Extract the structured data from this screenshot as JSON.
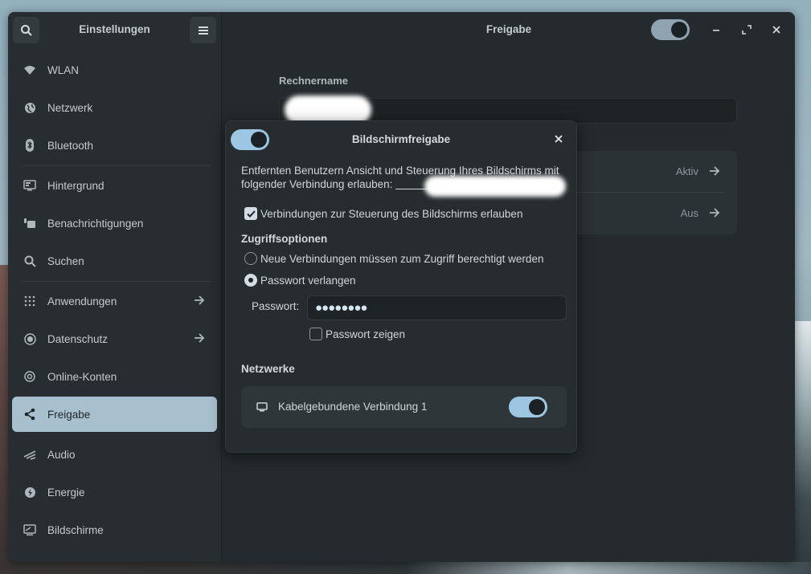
{
  "sidebar": {
    "title": "Einstellungen",
    "items": [
      {
        "label": "WLAN",
        "icon": "wifi-icon"
      },
      {
        "label": "Netzwerk",
        "icon": "network-globe-icon"
      },
      {
        "label": "Bluetooth",
        "icon": "bluetooth-icon"
      },
      {
        "label": "Hintergrund",
        "icon": "background-icon"
      },
      {
        "label": "Benachrichtigungen",
        "icon": "notifications-icon"
      },
      {
        "label": "Suchen",
        "icon": "search-icon"
      },
      {
        "label": "Anwendungen",
        "icon": "apps-grid-icon"
      },
      {
        "label": "Datenschutz",
        "icon": "privacy-icon"
      },
      {
        "label": "Online-Konten",
        "icon": "at-icon"
      },
      {
        "label": "Freigabe",
        "icon": "share-icon"
      },
      {
        "label": "Audio",
        "icon": "audio-icon"
      },
      {
        "label": "Energie",
        "icon": "power-icon"
      },
      {
        "label": "Bildschirme",
        "icon": "display-icon"
      }
    ]
  },
  "content": {
    "title": "Freigabe",
    "rechnername_label": "Rechnername",
    "rows": [
      {
        "state": "Aktiv"
      },
      {
        "state": "Aus"
      }
    ]
  },
  "dialog": {
    "title": "Bildschirmfreigabe",
    "description": "Entfernten Benutzern Ansicht und Steuerung Ihres Bildschirms mit folgender Verbindung erlauben: ",
    "allow_control_label": "Verbindungen zur Steuerung des Bildschirms erlauben",
    "access_options_heading": "Zugriffsoptionen",
    "option_new_connections": "Neue Verbindungen müssen zum Zugriff berechtigt werden",
    "option_password": "Passwort verlangen",
    "password_label": "Passwort:",
    "password_value": "●●●●●●●●",
    "show_password_label": "Passwort zeigen",
    "networks_heading": "Netzwerke",
    "network_name": "Kabelgebundene Verbindung 1"
  },
  "colors": {
    "accent": "#9dc6e2",
    "active_sidebar": "#a8c0cd",
    "window_bg": "#242a2d"
  }
}
